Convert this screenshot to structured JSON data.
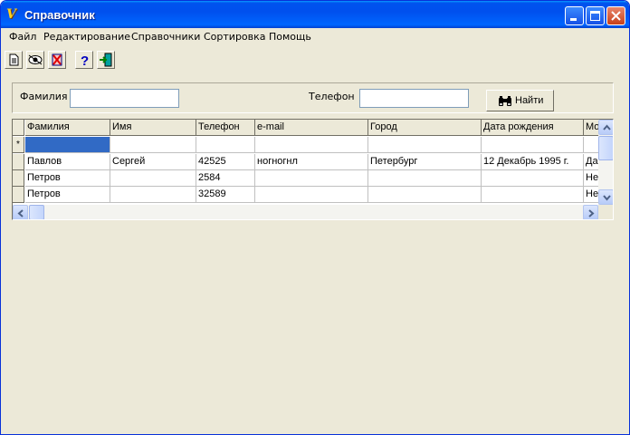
{
  "window": {
    "title": "Справочник"
  },
  "menu": [
    "Файл",
    "Редактирование",
    "Справочники",
    "Сортировка",
    "Помощь"
  ],
  "toolbar_icons": [
    "new-document-icon",
    "view-icon",
    "delete-icon",
    "help-icon",
    "exit-icon"
  ],
  "search": {
    "surname_label": "Фамилия",
    "surname_value": "",
    "phone_label": "Телефон",
    "phone_value": "",
    "find_label": "Найти"
  },
  "grid": {
    "new_row_marker": "*",
    "columns": [
      "Фамилия",
      "Имя",
      "Телефон",
      "e-mail",
      "Город",
      "Дата рождения",
      "Мо"
    ],
    "rows": [
      [
        "",
        "",
        "",
        "",
        "",
        "",
        ""
      ],
      [
        "Павлов",
        "Сергей",
        "42525",
        "ногногнл",
        "Петербург",
        "12 Декабрь 1995 г.",
        "Да"
      ],
      [
        "Петров",
        "",
        "2584",
        "",
        "",
        "",
        "Не"
      ],
      [
        "Петров",
        "",
        "32589",
        "",
        "",
        "",
        "Не"
      ]
    ]
  },
  "colors": {
    "title_bar": "#0054e3",
    "face": "#ece9d8",
    "selection": "#316ac5"
  }
}
